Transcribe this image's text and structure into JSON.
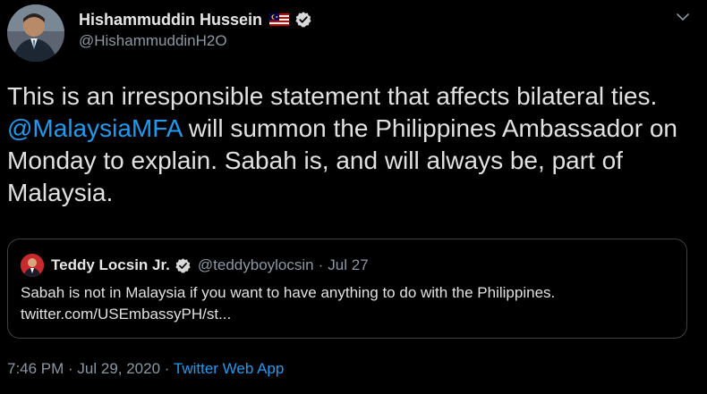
{
  "author": {
    "display_name": "Hishammuddin Hussein",
    "handle": "@HishammuddinH2O"
  },
  "tweet": {
    "text_before": "This is an irresponsible statement that affects bilateral ties. ",
    "mention": "@MalaysiaMFA",
    "text_after": " will summon the Philippines Ambassador on Monday to explain. Sabah is, and will always be, part of Malaysia."
  },
  "quote": {
    "display_name": "Teddy Locsin Jr.",
    "handle": "@teddyboylocsin",
    "separator": "·",
    "date": "Jul 27",
    "text": "Sabah is not in Malaysia if you want to have anything to do with the Philippines.",
    "link": "twitter.com/USEmbassyPH/st..."
  },
  "meta": {
    "time": "7:46 PM",
    "sep1": " · ",
    "date": "Jul 29, 2020",
    "sep2": " · ",
    "source": "Twitter Web App"
  },
  "colors": {
    "background": "#000000",
    "link": "#1d9bf0",
    "secondary_text": "#8b98a5",
    "verified_badge": "#d9d9d9"
  },
  "icons": {
    "flag": "malaysia-flag-icon",
    "verified": "verified-badge-icon",
    "menu": "chevron-down-icon"
  }
}
